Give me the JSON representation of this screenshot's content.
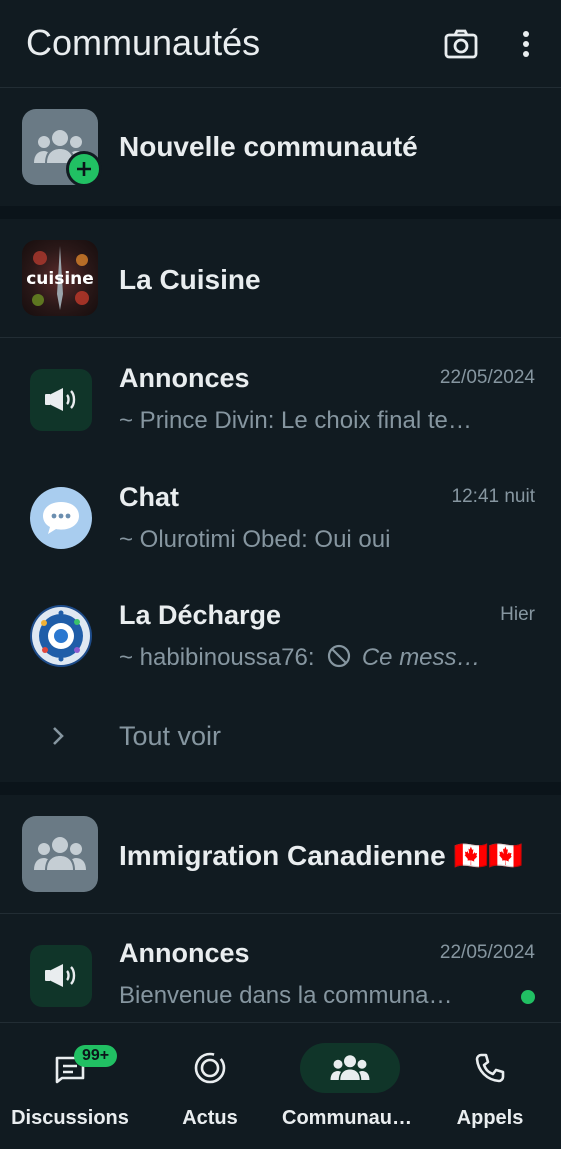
{
  "header": {
    "title": "Communautés",
    "camera_icon": "camera-icon",
    "menu_icon": "more-vertical-icon"
  },
  "new_community": {
    "label": "Nouvelle communauté",
    "icon": "group-icon",
    "badge_icon": "plus-icon"
  },
  "communities": [
    {
      "name": "La Cuisine",
      "avatar_text": "cuisine",
      "channels": [
        {
          "name": "Annonces",
          "preview": "~ Prince Divin: Le choix final te…",
          "time": "22/05/2024",
          "icon": "megaphone-icon"
        },
        {
          "name": "Chat",
          "preview": "~ Olurotimi Obed: Oui oui",
          "time": "12:41 nuit",
          "icon": "chat-bubble-icon"
        },
        {
          "name": "La Décharge",
          "preview_sender": "~ habibinoussa76:",
          "preview_deleted": "Ce mess…",
          "time": "Hier",
          "icon": "deleted-icon"
        }
      ],
      "see_all": "Tout voir"
    },
    {
      "name": "Immigration Canadienne 🇨🇦🇨🇦",
      "channels": [
        {
          "name": "Annonces",
          "preview": "Bienvenue dans la communa…",
          "time": "22/05/2024",
          "icon": "megaphone-icon",
          "unread": true
        }
      ]
    }
  ],
  "bottom_nav": [
    {
      "label": "Discussions",
      "icon": "chats-icon",
      "badge": "99+"
    },
    {
      "label": "Actus",
      "icon": "status-icon"
    },
    {
      "label": "Communaut…",
      "icon": "communities-icon",
      "active": true
    },
    {
      "label": "Appels",
      "icon": "phone-icon"
    }
  ],
  "colors": {
    "accent": "#21c063",
    "background": "#0b141a",
    "surface": "#111b21",
    "muted": "#8696a0"
  }
}
